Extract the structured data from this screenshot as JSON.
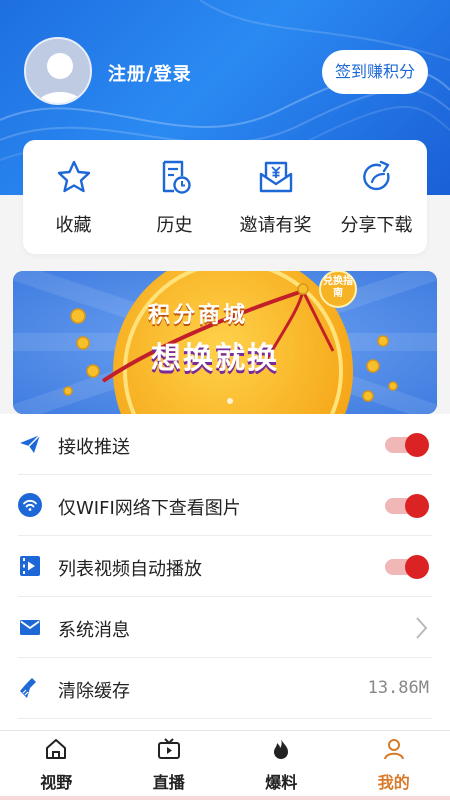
{
  "header": {
    "login_label": "注册/登录",
    "checkin_label": "签到赚积分"
  },
  "quick_actions": [
    {
      "label": "收藏",
      "icon": "star-icon"
    },
    {
      "label": "历史",
      "icon": "history-icon"
    },
    {
      "label": "邀请有奖",
      "icon": "invite-icon"
    },
    {
      "label": "分享下载",
      "icon": "share-icon"
    }
  ],
  "banner": {
    "title_line1": "积分商城",
    "title_line2": "想换就换",
    "badge": "兑换指南"
  },
  "settings": [
    {
      "label": "接收推送",
      "icon": "send-icon",
      "control": "toggle",
      "on": true
    },
    {
      "label": "仅WIFI网络下查看图片",
      "icon": "wifi-icon",
      "control": "toggle",
      "on": true
    },
    {
      "label": "列表视频自动播放",
      "icon": "video-icon",
      "control": "toggle",
      "on": true
    },
    {
      "label": "系统消息",
      "icon": "mail-icon",
      "control": "chevron"
    },
    {
      "label": "清除缓存",
      "icon": "broom-icon",
      "control": "value",
      "value": "13.86M"
    }
  ],
  "tabs": [
    {
      "label": "视野",
      "icon": "home-icon",
      "active": false
    },
    {
      "label": "直播",
      "icon": "tv-icon",
      "active": false
    },
    {
      "label": "爆料",
      "icon": "fire-icon",
      "active": false
    },
    {
      "label": "我的",
      "icon": "user-icon",
      "active": true
    }
  ],
  "colors": {
    "brand_blue": "#1d68d6",
    "toggle_on": "#dc2323",
    "active_tab": "#d87a2a"
  }
}
